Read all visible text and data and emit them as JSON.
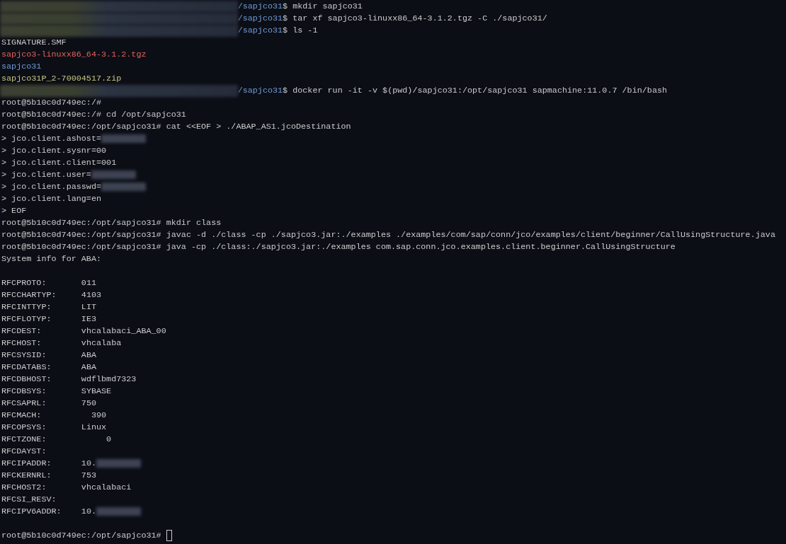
{
  "terminal": {
    "lines": [
      {
        "segments": [
          {
            "kind": "redacted_prompt"
          },
          {
            "kind": "path",
            "text": "/sapjco31"
          },
          {
            "kind": "plain",
            "text": "$ mkdir sapjco31"
          }
        ]
      },
      {
        "segments": [
          {
            "kind": "redacted_prompt"
          },
          {
            "kind": "path",
            "text": "/sapjco31"
          },
          {
            "kind": "plain",
            "text": "$ tar xf sapjco3-linuxx86_64-3.1.2.tgz -C ./sapjco31/"
          }
        ]
      },
      {
        "segments": [
          {
            "kind": "redacted_prompt"
          },
          {
            "kind": "path",
            "text": "/sapjco31"
          },
          {
            "kind": "plain",
            "text": "$ ls -1"
          }
        ]
      },
      {
        "segments": [
          {
            "kind": "plain",
            "text": "SIGNATURE.SMF"
          }
        ]
      },
      {
        "segments": [
          {
            "kind": "archive",
            "text": "sapjco3-linuxx86_64-3.1.2.tgz"
          }
        ]
      },
      {
        "segments": [
          {
            "kind": "directory",
            "text": "sapjco31"
          }
        ]
      },
      {
        "segments": [
          {
            "kind": "zip",
            "text": "sapjco31P_2-70004517.zip"
          }
        ]
      },
      {
        "segments": [
          {
            "kind": "redacted_prompt"
          },
          {
            "kind": "path",
            "text": "/sapjco31"
          },
          {
            "kind": "plain",
            "text": "$ docker run -it -v $(pwd)/sapjco31:/opt/sapjco31 sapmachine:11.0.7 /bin/bash"
          }
        ]
      },
      {
        "segments": [
          {
            "kind": "plain",
            "text": "root@5b10c0d749ec:/#"
          }
        ]
      },
      {
        "segments": [
          {
            "kind": "plain",
            "text": "root@5b10c0d749ec:/# cd /opt/sapjco31"
          }
        ]
      },
      {
        "segments": [
          {
            "kind": "plain",
            "text": "root@5b10c0d749ec:/opt/sapjco31# cat <<EOF > ./ABAP_AS1.jcoDestination"
          }
        ]
      },
      {
        "segments": [
          {
            "kind": "plain",
            "text": "> jco.client.ashost="
          },
          {
            "kind": "redacted_value"
          }
        ]
      },
      {
        "segments": [
          {
            "kind": "plain",
            "text": "> jco.client.sysnr=00"
          }
        ]
      },
      {
        "segments": [
          {
            "kind": "plain",
            "text": "> jco.client.client=001"
          }
        ]
      },
      {
        "segments": [
          {
            "kind": "plain",
            "text": "> jco.client.user="
          },
          {
            "kind": "redacted_value"
          }
        ]
      },
      {
        "segments": [
          {
            "kind": "plain",
            "text": "> jco.client.passwd="
          },
          {
            "kind": "redacted_value"
          }
        ]
      },
      {
        "segments": [
          {
            "kind": "plain",
            "text": "> jco.client.lang=en"
          }
        ]
      },
      {
        "segments": [
          {
            "kind": "plain",
            "text": "> EOF"
          }
        ]
      },
      {
        "segments": [
          {
            "kind": "plain",
            "text": "root@5b10c0d749ec:/opt/sapjco31# mkdir class"
          }
        ]
      },
      {
        "segments": [
          {
            "kind": "plain",
            "text": "root@5b10c0d749ec:/opt/sapjco31# javac -d ./class -cp ./sapjco3.jar:./examples ./examples/com/sap/conn/jco/examples/client/beginner/CallUsingStructure.java"
          }
        ]
      },
      {
        "segments": [
          {
            "kind": "plain",
            "text": "root@5b10c0d749ec:/opt/sapjco31# java -cp ./class:./sapjco3.jar:./examples com.sap.conn.jco.examples.client.beginner.CallUsingStructure"
          }
        ]
      },
      {
        "segments": [
          {
            "kind": "plain",
            "text": "System info for ABA:"
          }
        ]
      },
      {
        "blank_line_before": true,
        "segments": [
          {
            "kind": "plain",
            "text": "RFCPROTO:\t011"
          }
        ]
      },
      {
        "segments": [
          {
            "kind": "plain",
            "text": "RFCCHARTYP:\t4103"
          }
        ]
      },
      {
        "segments": [
          {
            "kind": "plain",
            "text": "RFCINTTYP:\tLIT"
          }
        ]
      },
      {
        "segments": [
          {
            "kind": "plain",
            "text": "RFCFLOTYP:\tIE3"
          }
        ]
      },
      {
        "segments": [
          {
            "kind": "plain",
            "text": "RFCDEST:\tvhcalabaci_ABA_00"
          }
        ]
      },
      {
        "segments": [
          {
            "kind": "plain",
            "text": "RFCHOST:\tvhcalaba"
          }
        ]
      },
      {
        "segments": [
          {
            "kind": "plain",
            "text": "RFCSYSID:\tABA"
          }
        ]
      },
      {
        "segments": [
          {
            "kind": "plain",
            "text": "RFCDATABS:\tABA"
          }
        ]
      },
      {
        "segments": [
          {
            "kind": "plain",
            "text": "RFCDBHOST:\twdflbmd7323"
          }
        ]
      },
      {
        "segments": [
          {
            "kind": "plain",
            "text": "RFCDBSYS:\tSYBASE"
          }
        ]
      },
      {
        "segments": [
          {
            "kind": "plain",
            "text": "RFCSAPRL:\t750"
          }
        ]
      },
      {
        "segments": [
          {
            "kind": "plain",
            "text": "RFCMACH:\t  390"
          }
        ]
      },
      {
        "segments": [
          {
            "kind": "plain",
            "text": "RFCOPSYS:\tLinux"
          }
        ]
      },
      {
        "segments": [
          {
            "kind": "plain",
            "text": "RFCTZONE:\t     0"
          }
        ]
      },
      {
        "segments": [
          {
            "kind": "plain",
            "text": "RFCDAYST:"
          }
        ]
      },
      {
        "segments": [
          {
            "kind": "plain",
            "text": "RFCIPADDR:\t10."
          },
          {
            "kind": "redacted_value"
          }
        ]
      },
      {
        "segments": [
          {
            "kind": "plain",
            "text": "RFCKERNRL:\t753"
          }
        ]
      },
      {
        "segments": [
          {
            "kind": "plain",
            "text": "RFCHOST2:\tvhcalabaci"
          }
        ]
      },
      {
        "segments": [
          {
            "kind": "plain",
            "text": "RFCSI_RESV:"
          }
        ]
      },
      {
        "segments": [
          {
            "kind": "plain",
            "text": "RFCIPV6ADDR:\t10."
          },
          {
            "kind": "redacted_value"
          }
        ]
      },
      {
        "blank_line_before": true,
        "segments": [
          {
            "kind": "plain",
            "text": "root@5b10c0d749ec:/opt/sapjco31# "
          },
          {
            "kind": "cursor"
          }
        ]
      }
    ]
  }
}
